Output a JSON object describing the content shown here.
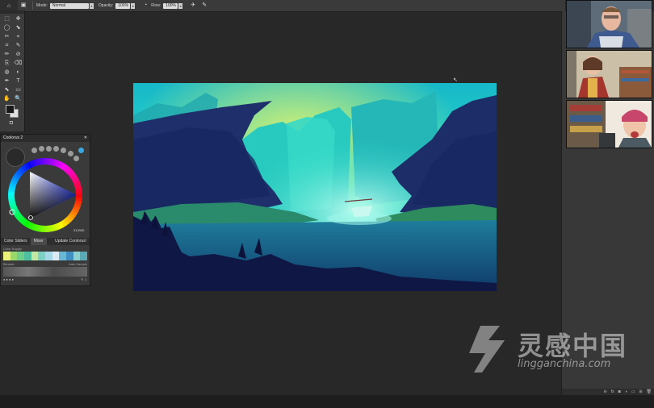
{
  "options_bar": {
    "home_icon": "brush-preset-icon",
    "mode_label": "Mode:",
    "mode_value": "Normal",
    "opacity_label": "Opacity:",
    "opacity_value": "100%",
    "flow_label": "Flow:",
    "flow_value": "100%"
  },
  "tools": {
    "items": [
      "⬚",
      "✥",
      "◯",
      "⬊",
      "✂",
      "⌖",
      "⌗",
      "✎",
      "✏",
      "⊘",
      "⎘",
      "⌫",
      "◍",
      "◐",
      "✒",
      "T",
      "⬉",
      "▭",
      "✋",
      "🔍"
    ],
    "quickmask_icon": "◘"
  },
  "coolorus": {
    "title": "Coolorus 2",
    "close": "✕",
    "dot_labels": [
      "",
      "",
      "",
      "",
      "",
      "",
      "",
      ""
    ],
    "hex_value": "313330",
    "tabs": [
      "Color Sliders",
      "Mixer",
      "Update Coolorus!"
    ],
    "sub_label": "Color Supply",
    "palette_colors": [
      "#e9f17a",
      "#9ad86c",
      "#6fcf8a",
      "#4fbfa2",
      "#c2e8a4",
      "#7ecfc4",
      "#a6d9e8",
      "#dbe9f2",
      "#68b7d6",
      "#3f8fc0",
      "#8fd0ce",
      "#5aa9b7"
    ],
    "row_left": "Blender",
    "row_right": "Auto Sample"
  },
  "right_panel": {
    "bottom_icons": [
      "⊖",
      "fx",
      "◙",
      "◑",
      "▭",
      "⊞",
      "🗑"
    ]
  },
  "watermark": {
    "chinese": "灵感中国",
    "domain": "lingganchina.com"
  },
  "colors": {
    "app_bg": "#282828",
    "panel": "#3a3a3a",
    "painting_sky": "#1fd3c9",
    "painting_dark": "#1b2356"
  }
}
